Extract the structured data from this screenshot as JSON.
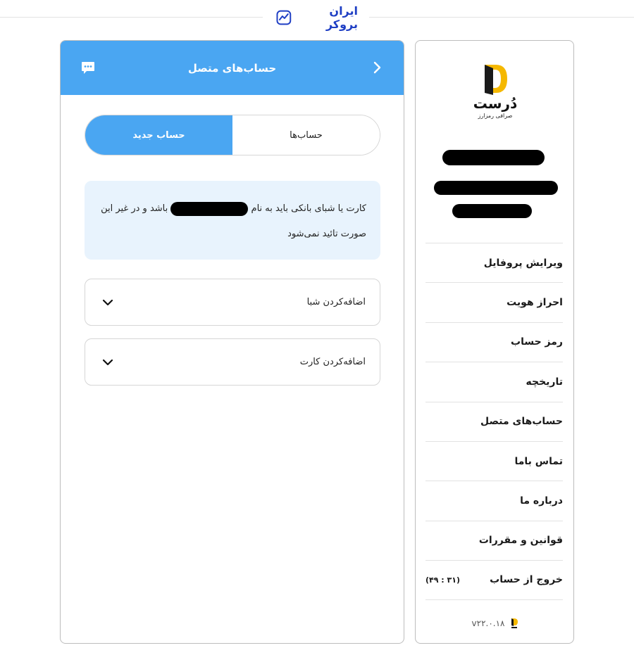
{
  "brand": {
    "name": "ایران بروکر",
    "color": "#1f3fc4"
  },
  "main": {
    "title": "حساب‌های متصل",
    "header_color": "#4aa6f2",
    "icons": {
      "back": "chevron-right-icon",
      "chat": "chat-bubble-icon"
    },
    "tabs": [
      {
        "label": "حساب‌ها",
        "active": false
      },
      {
        "label": "حساب جدید",
        "active": true
      }
    ],
    "notice": {
      "before": "کارت یا شبای بانکی باید به نام",
      "after": "باشد و در غیر این صورت تائید نمی‌شود"
    },
    "accordions": [
      {
        "label": "اضافه‌کردن شبا"
      },
      {
        "label": "اضافه‌کردن کارت"
      }
    ]
  },
  "side": {
    "logo": {
      "name": "دُرست",
      "subtitle": "صرافی رمزارز",
      "color": "#f5b800"
    },
    "menu": [
      {
        "label": "ویرایش پروفایل"
      },
      {
        "label": "احراز هویت"
      },
      {
        "label": "رمز حساب"
      },
      {
        "label": "تاریخچه"
      },
      {
        "label": "حساب‌های متصل"
      },
      {
        "label": "تماس باما"
      },
      {
        "label": "درباره ما"
      },
      {
        "label": "قوانین و مقررات"
      },
      {
        "label": "خروج از حساب",
        "timer": "(۳۱ : ۴۹)"
      }
    ],
    "version": "v۲۲.۰.۱۸"
  }
}
